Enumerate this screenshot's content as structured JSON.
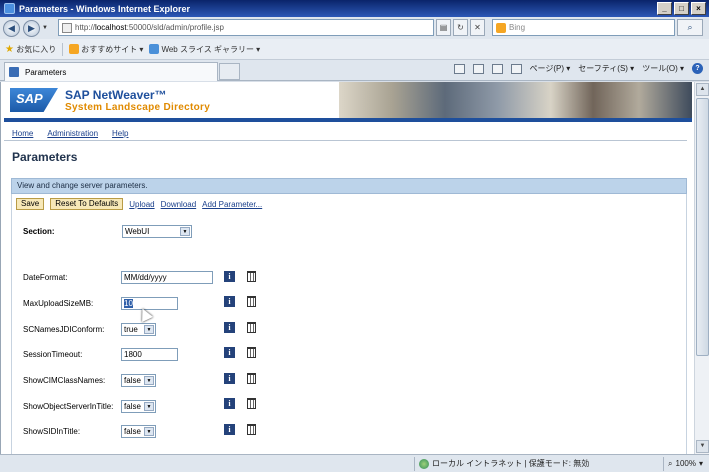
{
  "window": {
    "title": "Parameters - Windows Internet Explorer"
  },
  "address_bar": {
    "url_prefix": "http://",
    "url_host": "localhost",
    "url_rest": ":50000/sld/admin/profile.jsp",
    "search_placeholder": "Bing"
  },
  "favorites_bar": {
    "favorites_label": "お気に入り",
    "suggested_sites": "おすすめサイト ▾",
    "web_slice": "Web スライス ギャラリー ▾"
  },
  "tab": {
    "title": "Parameters"
  },
  "command_bar": {
    "page": "ページ(P) ▾",
    "safety": "セーフティ(S) ▾",
    "tools": "ツール(O) ▾",
    "help": "?"
  },
  "sap": {
    "logo": "SAP",
    "product": "SAP NetWeaver™",
    "subtitle": "System Landscape Directory"
  },
  "nav": {
    "home": "Home",
    "administration": "Administration",
    "help": "Help"
  },
  "page_title": "Parameters",
  "panel_header": "View and change server parameters.",
  "toolbar": {
    "save": "Save",
    "reset": "Reset To Defaults",
    "upload": "Upload",
    "download": "Download",
    "add_parameter": "Add Parameter..."
  },
  "section": {
    "label": "Section:",
    "value": "WebUI"
  },
  "params": [
    {
      "name": "DateFormat:",
      "value": "MM/dd/yyyy"
    },
    {
      "name": "MaxUploadSizeMB:",
      "value": "10"
    },
    {
      "name": "SCNamesJDIConform:",
      "value": "true"
    },
    {
      "name": "SessionTimeout:",
      "value": "1800"
    },
    {
      "name": "ShowCIMClassNames:",
      "value": "false"
    },
    {
      "name": "ShowObjectServerInTitle:",
      "value": "false"
    },
    {
      "name": "ShowSIDInTitle:",
      "value": "false"
    }
  ],
  "status_bar": {
    "zone": "ローカル イントラネット | 保護モード: 無効",
    "zoom": "100%"
  },
  "colors": {
    "sap_blue": "#1e4f9c",
    "sap_orange": "#e08a00",
    "panel_header": "#bcd3ea",
    "button_fill": "#f7e8b8"
  }
}
